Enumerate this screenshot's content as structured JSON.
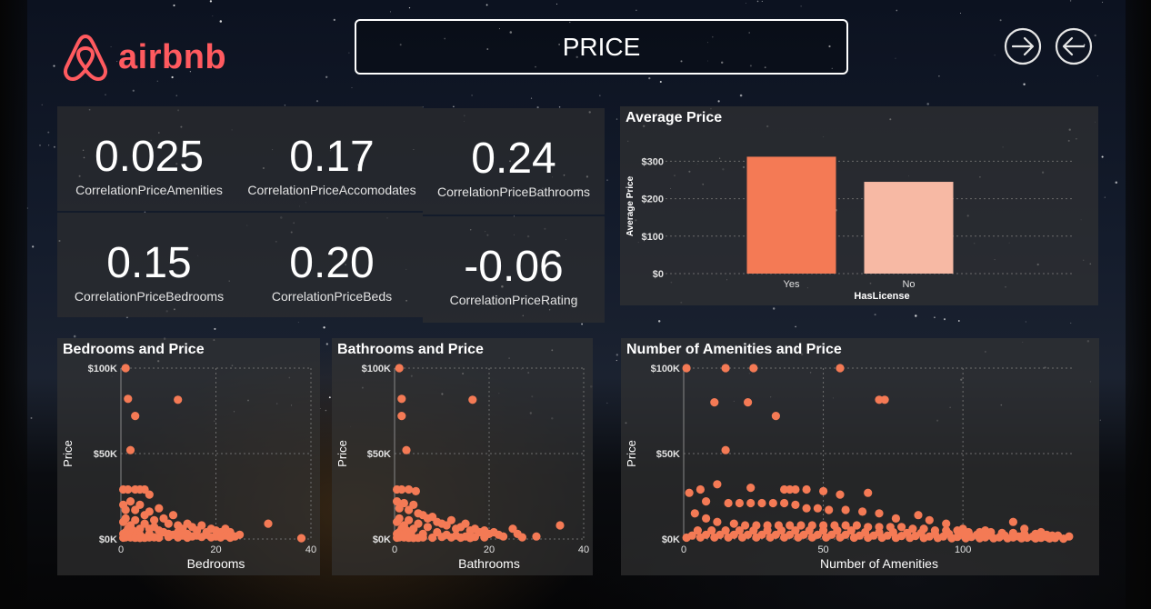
{
  "header": {
    "logo_text": "airbnb",
    "page_title": "PRICE",
    "brand_color": "#ff5a5f",
    "next_icon": "arrow-right-circle-icon",
    "back_icon": "arrow-left-circle-icon"
  },
  "kpis": [
    {
      "value": "0.025",
      "label": "CorrelationPriceAmenities"
    },
    {
      "value": "0.17",
      "label": "CorrelationPriceAccomodates"
    },
    {
      "value": "0.24",
      "label": "CorrelationPriceBathrooms"
    },
    {
      "value": "0.15",
      "label": "CorrelationPriceBedrooms"
    },
    {
      "value": "0.20",
      "label": "CorrelationPriceBeds"
    },
    {
      "value": "-0.06",
      "label": "CorrelationPriceRating"
    }
  ],
  "chart_data": [
    {
      "id": "avgprice",
      "type": "bar",
      "title": "Average Price",
      "xlabel": "HasLicense",
      "ylabel": "Average Price",
      "categories": [
        "Yes",
        "No"
      ],
      "values": [
        312,
        245
      ],
      "ylim": [
        0,
        330
      ],
      "yticks": [
        0,
        100,
        200,
        300
      ],
      "ytick_labels": [
        "$0",
        "$100",
        "$200",
        "$300"
      ],
      "colors": [
        "#f47a55",
        "#f7b9a4"
      ],
      "grid": true
    },
    {
      "id": "bedrooms",
      "type": "scatter",
      "title": "Bedrooms and Price",
      "xlabel": "Bedrooms",
      "ylabel": "Price",
      "xlim": [
        0,
        40
      ],
      "ylim": [
        0,
        100000
      ],
      "xticks": [
        0,
        20,
        40
      ],
      "xtick_labels": [
        "0",
        "20",
        "40"
      ],
      "yticks": [
        0,
        50000,
        100000
      ],
      "ytick_labels": [
        "$0K",
        "$50K",
        "$100K"
      ],
      "color": "#f47a55",
      "grid": true,
      "points": [
        [
          1,
          100000
        ],
        [
          1.5,
          82000
        ],
        [
          12,
          81500
        ],
        [
          3,
          72000
        ],
        [
          2,
          52000
        ],
        [
          0.5,
          29000
        ],
        [
          1.5,
          29000
        ],
        [
          3,
          29000
        ],
        [
          4,
          29000
        ],
        [
          5,
          29000
        ],
        [
          6,
          26000
        ],
        [
          0.5,
          20000
        ],
        [
          1,
          17000
        ],
        [
          2,
          22000
        ],
        [
          3,
          17000
        ],
        [
          4,
          20000
        ],
        [
          5,
          14000
        ],
        [
          6,
          16000
        ],
        [
          7,
          11000
        ],
        [
          8,
          18000
        ],
        [
          9,
          12000
        ],
        [
          10,
          9000
        ],
        [
          11,
          14000
        ],
        [
          12,
          8000
        ],
        [
          13,
          6000
        ],
        [
          14,
          9000
        ],
        [
          15,
          7000
        ],
        [
          16,
          5000
        ],
        [
          17,
          8000
        ],
        [
          18,
          4000
        ],
        [
          19,
          6000
        ],
        [
          20,
          5000
        ],
        [
          21,
          4000
        ],
        [
          22,
          6000
        ],
        [
          23,
          4000
        ],
        [
          24,
          1500
        ],
        [
          6,
          6000
        ],
        [
          8,
          5000
        ],
        [
          10,
          3000
        ],
        [
          12,
          4000
        ],
        [
          14,
          3000
        ],
        [
          16,
          2000
        ],
        [
          18,
          2500
        ],
        [
          20,
          1500
        ],
        [
          22,
          2000
        ],
        [
          25,
          2500
        ],
        [
          31,
          9000
        ],
        [
          38,
          500
        ],
        [
          0.5,
          10000
        ],
        [
          1,
          12000
        ],
        [
          2,
          8000
        ],
        [
          3,
          11000
        ],
        [
          4,
          6000
        ],
        [
          5,
          9000
        ],
        [
          6,
          3000
        ],
        [
          7,
          7000
        ],
        [
          9,
          4000
        ],
        [
          11,
          2500
        ],
        [
          13,
          2000
        ],
        [
          15,
          1500
        ],
        [
          17,
          1200
        ],
        [
          19,
          1000
        ],
        [
          21,
          900
        ],
        [
          23,
          800
        ],
        [
          0.5,
          3000
        ],
        [
          1,
          4000
        ],
        [
          1.5,
          6000
        ],
        [
          2,
          3000
        ],
        [
          2.5,
          5000
        ],
        [
          3,
          2000
        ],
        [
          3.5,
          4000
        ],
        [
          4,
          2500
        ],
        [
          0.5,
          800
        ],
        [
          1,
          1000
        ],
        [
          2,
          900
        ],
        [
          3,
          700
        ],
        [
          4,
          600
        ],
        [
          5,
          700
        ],
        [
          6,
          900
        ],
        [
          7,
          1000
        ],
        [
          8,
          800
        ],
        [
          10,
          1200
        ],
        [
          12,
          900
        ],
        [
          14,
          800
        ]
      ]
    },
    {
      "id": "bathrooms",
      "type": "scatter",
      "title": "Bathrooms and Price",
      "xlabel": "Bathrooms",
      "ylabel": "Price",
      "xlim": [
        0,
        40
      ],
      "ylim": [
        0,
        100000
      ],
      "xticks": [
        0,
        20,
        40
      ],
      "xtick_labels": [
        "0",
        "20",
        "40"
      ],
      "yticks": [
        0,
        50000,
        100000
      ],
      "ytick_labels": [
        "$0K",
        "$50K",
        "$100K"
      ],
      "color": "#f47a55",
      "grid": true,
      "points": [
        [
          1,
          100000
        ],
        [
          1.5,
          82000
        ],
        [
          16.5,
          81500
        ],
        [
          1.5,
          72000
        ],
        [
          2.5,
          52000
        ],
        [
          0.5,
          29000
        ],
        [
          1.5,
          29000
        ],
        [
          3,
          29000
        ],
        [
          4.5,
          28000
        ],
        [
          0.5,
          22000
        ],
        [
          1,
          18000
        ],
        [
          2,
          21000
        ],
        [
          3,
          17000
        ],
        [
          4,
          20000
        ],
        [
          5,
          15000
        ],
        [
          6,
          14000
        ],
        [
          7,
          12000
        ],
        [
          8,
          13000
        ],
        [
          9,
          10000
        ],
        [
          10,
          9000
        ],
        [
          11,
          8000
        ],
        [
          12,
          11000
        ],
        [
          13,
          6000
        ],
        [
          14,
          7000
        ],
        [
          15,
          9000
        ],
        [
          16,
          5000
        ],
        [
          17,
          6000
        ],
        [
          18,
          4000
        ],
        [
          19,
          5000
        ],
        [
          20,
          3000
        ],
        [
          21,
          4000
        ],
        [
          22,
          2500
        ],
        [
          23,
          1500
        ],
        [
          25,
          6000
        ],
        [
          26,
          3000
        ],
        [
          27,
          1000
        ],
        [
          30,
          1500
        ],
        [
          35,
          8000
        ],
        [
          0.5,
          10000
        ],
        [
          1,
          12000
        ],
        [
          2,
          8000
        ],
        [
          3,
          11000
        ],
        [
          4,
          6000
        ],
        [
          5,
          9000
        ],
        [
          6,
          3000
        ],
        [
          7,
          7000
        ],
        [
          9,
          4000
        ],
        [
          11,
          2500
        ],
        [
          13,
          2000
        ],
        [
          15,
          1500
        ],
        [
          17,
          1200
        ],
        [
          19,
          1000
        ],
        [
          0.5,
          3000
        ],
        [
          1,
          4000
        ],
        [
          1.5,
          6000
        ],
        [
          2,
          3000
        ],
        [
          2.5,
          5000
        ],
        [
          3,
          2000
        ],
        [
          3.5,
          4000
        ],
        [
          0.5,
          800
        ],
        [
          1,
          1000
        ],
        [
          2,
          900
        ],
        [
          3,
          700
        ],
        [
          4,
          600
        ],
        [
          5,
          700
        ],
        [
          6,
          900
        ],
        [
          8,
          800
        ],
        [
          10,
          1200
        ],
        [
          12,
          900
        ],
        [
          14,
          800
        ],
        [
          16,
          600
        ]
      ]
    },
    {
      "id": "amenities",
      "type": "scatter",
      "title": "Number of Amenities and Price",
      "xlabel": "Number of Amenities",
      "ylabel": "Price",
      "xlim": [
        0,
        140
      ],
      "ylim": [
        0,
        100000
      ],
      "xticks": [
        0,
        50,
        100
      ],
      "xtick_labels": [
        "0",
        "50",
        "100"
      ],
      "yticks": [
        0,
        50000,
        100000
      ],
      "ytick_labels": [
        "$0K",
        "$50K",
        "$100K"
      ],
      "color": "#f47a55",
      "grid": true,
      "points": [
        [
          1,
          100000
        ],
        [
          15,
          100000
        ],
        [
          25,
          100000
        ],
        [
          56,
          100000
        ],
        [
          11,
          80000
        ],
        [
          23,
          80000
        ],
        [
          70,
          81500
        ],
        [
          72,
          81500
        ],
        [
          33,
          72000
        ],
        [
          15,
          52000
        ],
        [
          2,
          27000
        ],
        [
          6,
          29000
        ],
        [
          12,
          32000
        ],
        [
          24,
          30000
        ],
        [
          36,
          29000
        ],
        [
          38,
          29000
        ],
        [
          40,
          29000
        ],
        [
          44,
          29000
        ],
        [
          50,
          28000
        ],
        [
          56,
          26000
        ],
        [
          66,
          27000
        ],
        [
          8,
          22000
        ],
        [
          16,
          21000
        ],
        [
          20,
          21000
        ],
        [
          24,
          21000
        ],
        [
          28,
          21000
        ],
        [
          32,
          21000
        ],
        [
          36,
          21000
        ],
        [
          40,
          20000
        ],
        [
          44,
          18000
        ],
        [
          48,
          18000
        ],
        [
          52,
          17000
        ],
        [
          58,
          17000
        ],
        [
          64,
          16000
        ],
        [
          70,
          15000
        ],
        [
          76,
          12000
        ],
        [
          84,
          14000
        ],
        [
          88,
          11000
        ],
        [
          94,
          9000
        ],
        [
          100,
          6000
        ],
        [
          108,
          5000
        ],
        [
          118,
          10000
        ],
        [
          122,
          6000
        ],
        [
          128,
          4000
        ],
        [
          132,
          2000
        ],
        [
          4,
          15000
        ],
        [
          8,
          12000
        ],
        [
          12,
          10000
        ],
        [
          18,
          9000
        ],
        [
          22,
          8000
        ],
        [
          26,
          8000
        ],
        [
          30,
          8000
        ],
        [
          34,
          8000
        ],
        [
          38,
          8000
        ],
        [
          42,
          8000
        ],
        [
          46,
          8000
        ],
        [
          50,
          8000
        ],
        [
          54,
          8000
        ],
        [
          58,
          8000
        ],
        [
          62,
          8000
        ],
        [
          66,
          7000
        ],
        [
          70,
          7000
        ],
        [
          74,
          7000
        ],
        [
          78,
          7000
        ],
        [
          82,
          6000
        ],
        [
          86,
          6000
        ],
        [
          90,
          5000
        ],
        [
          94,
          5000
        ],
        [
          98,
          5000
        ],
        [
          102,
          4000
        ],
        [
          106,
          4000
        ],
        [
          110,
          4000
        ],
        [
          114,
          3500
        ],
        [
          118,
          3500
        ],
        [
          122,
          3000
        ],
        [
          126,
          3000
        ],
        [
          130,
          2500
        ],
        [
          134,
          2000
        ],
        [
          138,
          1500
        ],
        [
          5,
          5000
        ],
        [
          10,
          5000
        ],
        [
          15,
          5000
        ],
        [
          20,
          5000
        ],
        [
          25,
          5000
        ],
        [
          30,
          5000
        ],
        [
          35,
          5000
        ],
        [
          40,
          5000
        ],
        [
          45,
          5000
        ],
        [
          50,
          5000
        ],
        [
          55,
          5000
        ],
        [
          60,
          5000
        ],
        [
          65,
          4000
        ],
        [
          70,
          4000
        ],
        [
          75,
          4000
        ],
        [
          80,
          3500
        ],
        [
          85,
          3500
        ],
        [
          90,
          3000
        ],
        [
          95,
          3000
        ],
        [
          100,
          2500
        ],
        [
          105,
          2500
        ],
        [
          110,
          2000
        ],
        [
          115,
          2000
        ],
        [
          120,
          1500
        ],
        [
          125,
          1500
        ],
        [
          130,
          1200
        ],
        [
          3,
          2000
        ],
        [
          8,
          2500
        ],
        [
          13,
          2500
        ],
        [
          18,
          2500
        ],
        [
          23,
          2500
        ],
        [
          28,
          2500
        ],
        [
          33,
          2500
        ],
        [
          38,
          2500
        ],
        [
          43,
          2500
        ],
        [
          48,
          2500
        ],
        [
          53,
          2500
        ],
        [
          58,
          2500
        ],
        [
          63,
          2000
        ],
        [
          68,
          2000
        ],
        [
          73,
          2000
        ],
        [
          78,
          1800
        ],
        [
          83,
          1800
        ],
        [
          88,
          1500
        ],
        [
          93,
          1500
        ],
        [
          98,
          1200
        ],
        [
          103,
          1200
        ],
        [
          108,
          1000
        ],
        [
          113,
          1000
        ],
        [
          118,
          900
        ],
        [
          123,
          800
        ],
        [
          128,
          700
        ],
        [
          133,
          600
        ],
        [
          1,
          800
        ],
        [
          6,
          900
        ],
        [
          11,
          900
        ],
        [
          16,
          900
        ],
        [
          21,
          900
        ],
        [
          26,
          900
        ],
        [
          31,
          900
        ],
        [
          36,
          900
        ],
        [
          41,
          900
        ],
        [
          46,
          900
        ],
        [
          51,
          900
        ],
        [
          56,
          900
        ],
        [
          61,
          800
        ],
        [
          66,
          800
        ],
        [
          71,
          800
        ],
        [
          76,
          700
        ],
        [
          81,
          700
        ],
        [
          86,
          600
        ],
        [
          91,
          600
        ],
        [
          96,
          500
        ],
        [
          101,
          500
        ],
        [
          106,
          500
        ],
        [
          111,
          400
        ],
        [
          116,
          400
        ],
        [
          121,
          400
        ],
        [
          126,
          300
        ],
        [
          131,
          300
        ],
        [
          136,
          200
        ]
      ]
    }
  ]
}
